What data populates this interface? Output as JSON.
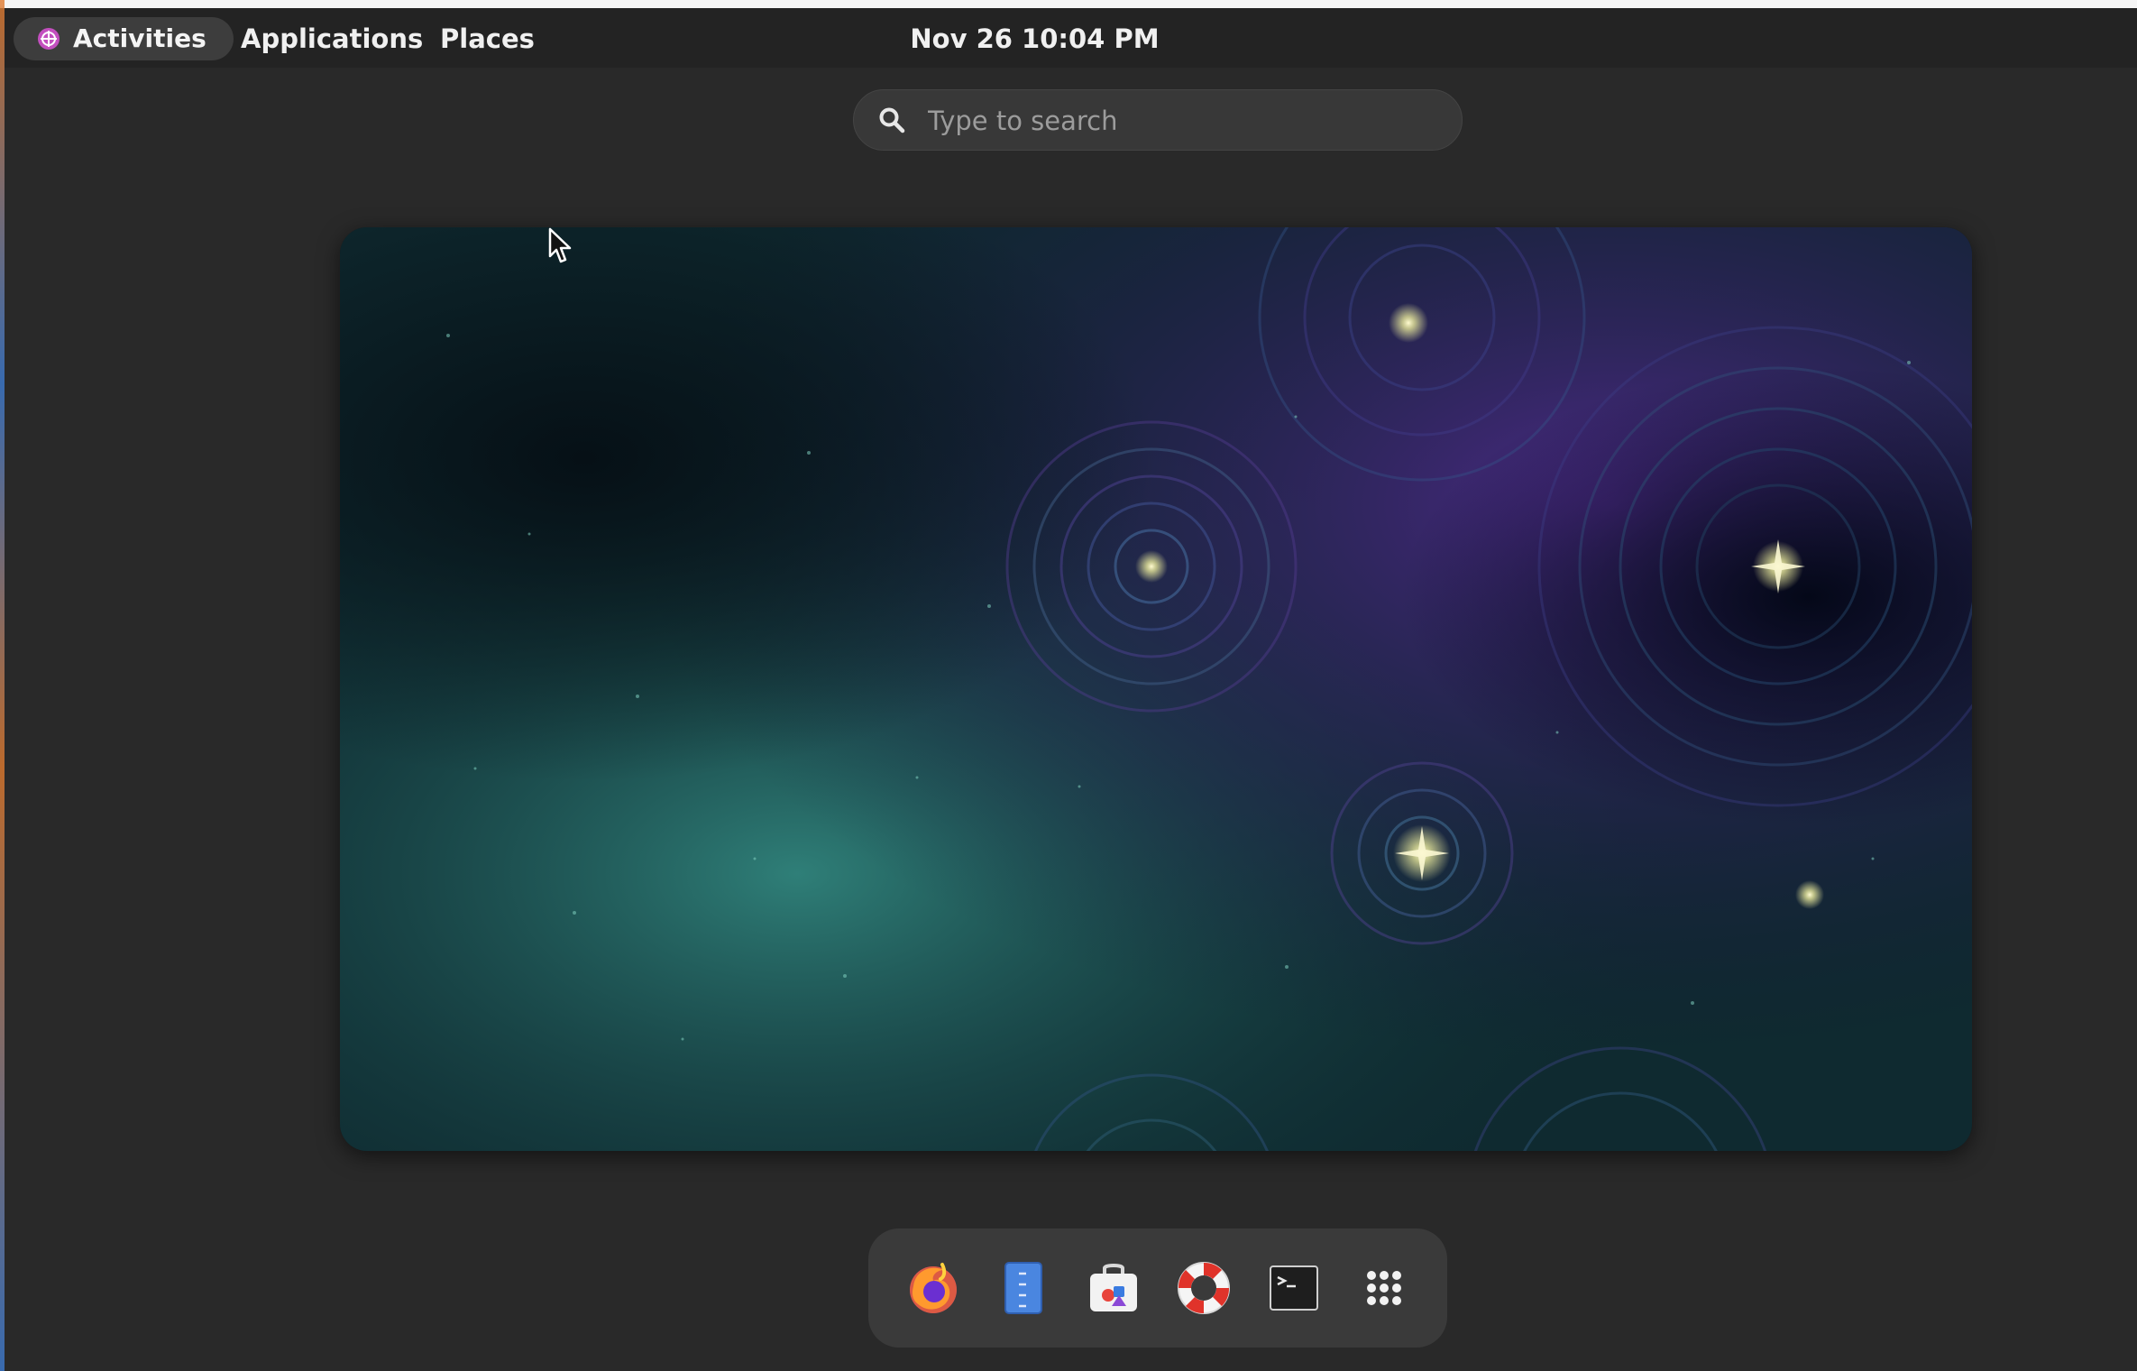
{
  "topbar": {
    "activities_label": "Activities",
    "applications_label": "Applications",
    "places_label": "Places",
    "clock": "Nov 26  10:04 PM"
  },
  "search": {
    "placeholder": "Type to search"
  },
  "workspace": {
    "wallpaper": "starry-swirl-nebula"
  },
  "dash": {
    "items": [
      {
        "app": "Firefox",
        "icon": "firefox-icon"
      },
      {
        "app": "Text Editor",
        "icon": "text-editor-icon"
      },
      {
        "app": "Software",
        "icon": "software-store-icon"
      },
      {
        "app": "Help",
        "icon": "lifebuoy-icon"
      },
      {
        "app": "Terminal",
        "icon": "terminal-icon"
      },
      {
        "app": "Show Applications",
        "icon": "app-grid-icon"
      }
    ]
  },
  "colors": {
    "panel": "#232323",
    "background": "#292929",
    "dash": "#3a3a3a",
    "search": "#383838",
    "accent_logo": "#c34fbf"
  }
}
